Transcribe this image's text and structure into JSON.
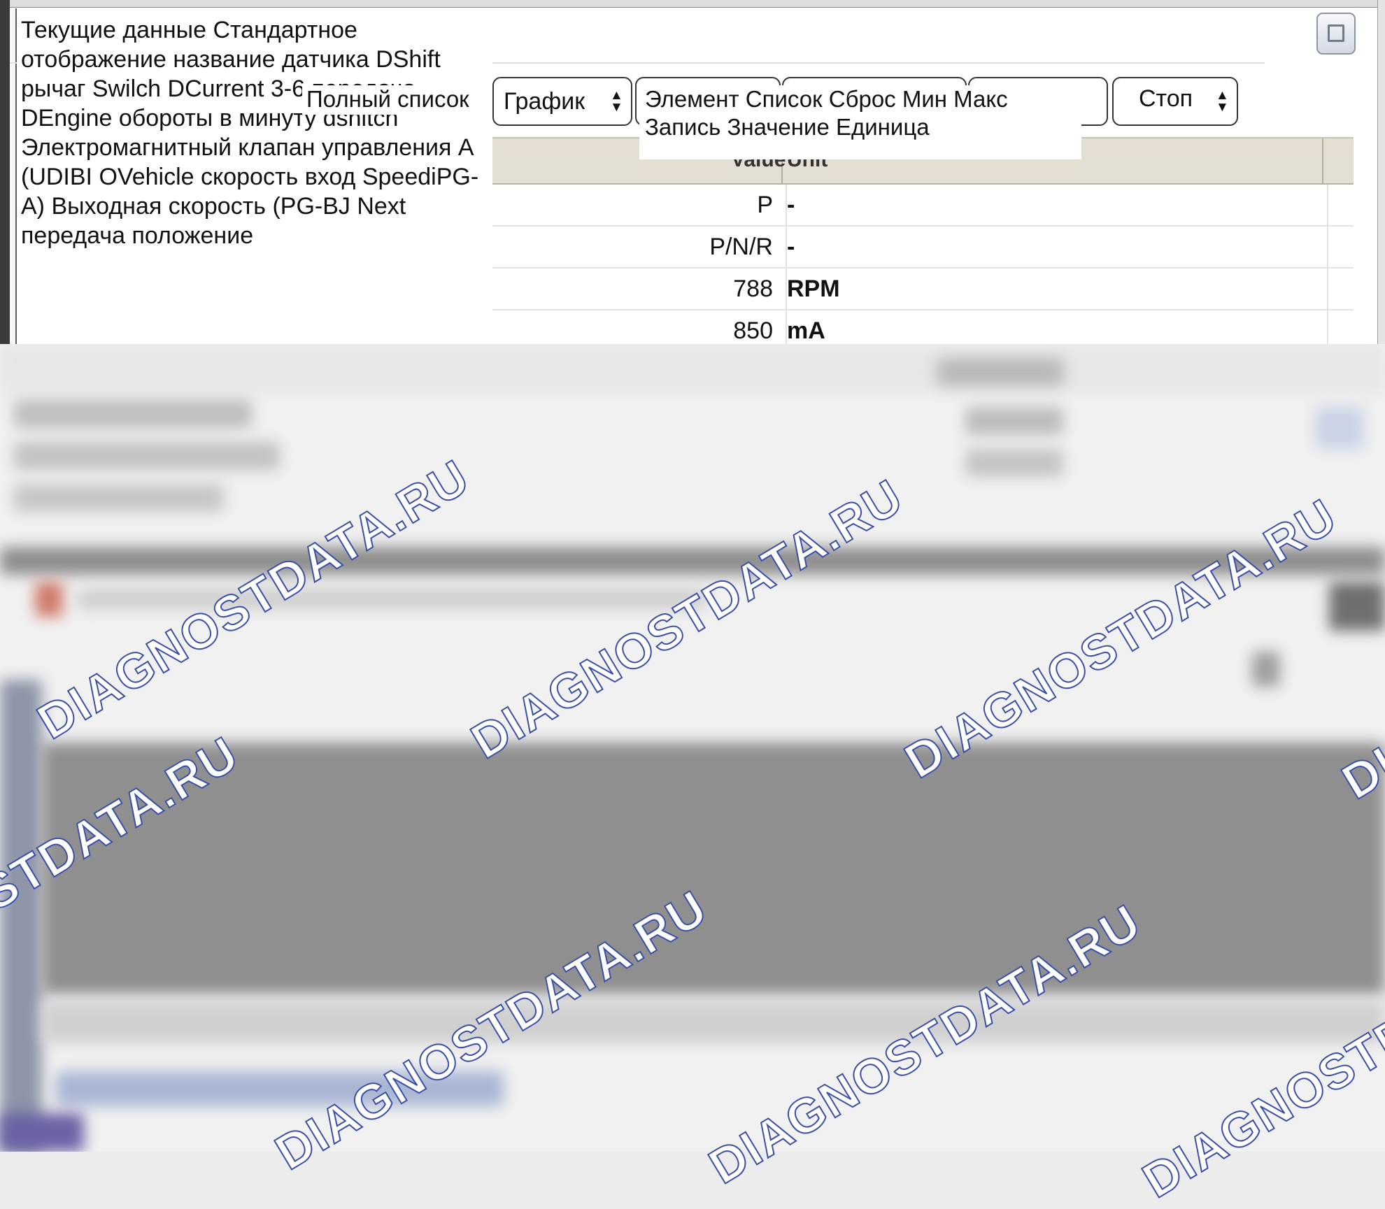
{
  "window": {
    "maximize_label": ""
  },
  "toolbar": {
    "full_list": "Полный список",
    "graph": "График",
    "stop": "Стоп",
    "column_tooltip": "Элемент Список Сброс Мин Макс Запись Значение Единица"
  },
  "parameters_tooltip": "Текущие данные Стандартное отображение название датчика DShift рычаг Swilch DCurrent 3-6 передача DEngine обороты в минуту dshitch Электромагнитный клапан управления A (UDIBI OVehicle скорость вход SpeediPG-A) Выходная скорость (PG-BJ Next передача положение",
  "table": {
    "headers": {
      "value": "Value",
      "unit": "Unit"
    },
    "rows": [
      {
        "value": "P",
        "unit": "-"
      },
      {
        "value": "P/N/R",
        "unit": "-"
      },
      {
        "value": "788",
        "unit": "RPM"
      },
      {
        "value": "850",
        "unit": "mA"
      }
    ]
  },
  "watermark": "DIAGNOSTDATA.RU",
  "colors": {
    "watermark_outline": "#3a4fa8",
    "header_bg": "#e3dfd3",
    "frame_dark": "#3a3a3a"
  }
}
